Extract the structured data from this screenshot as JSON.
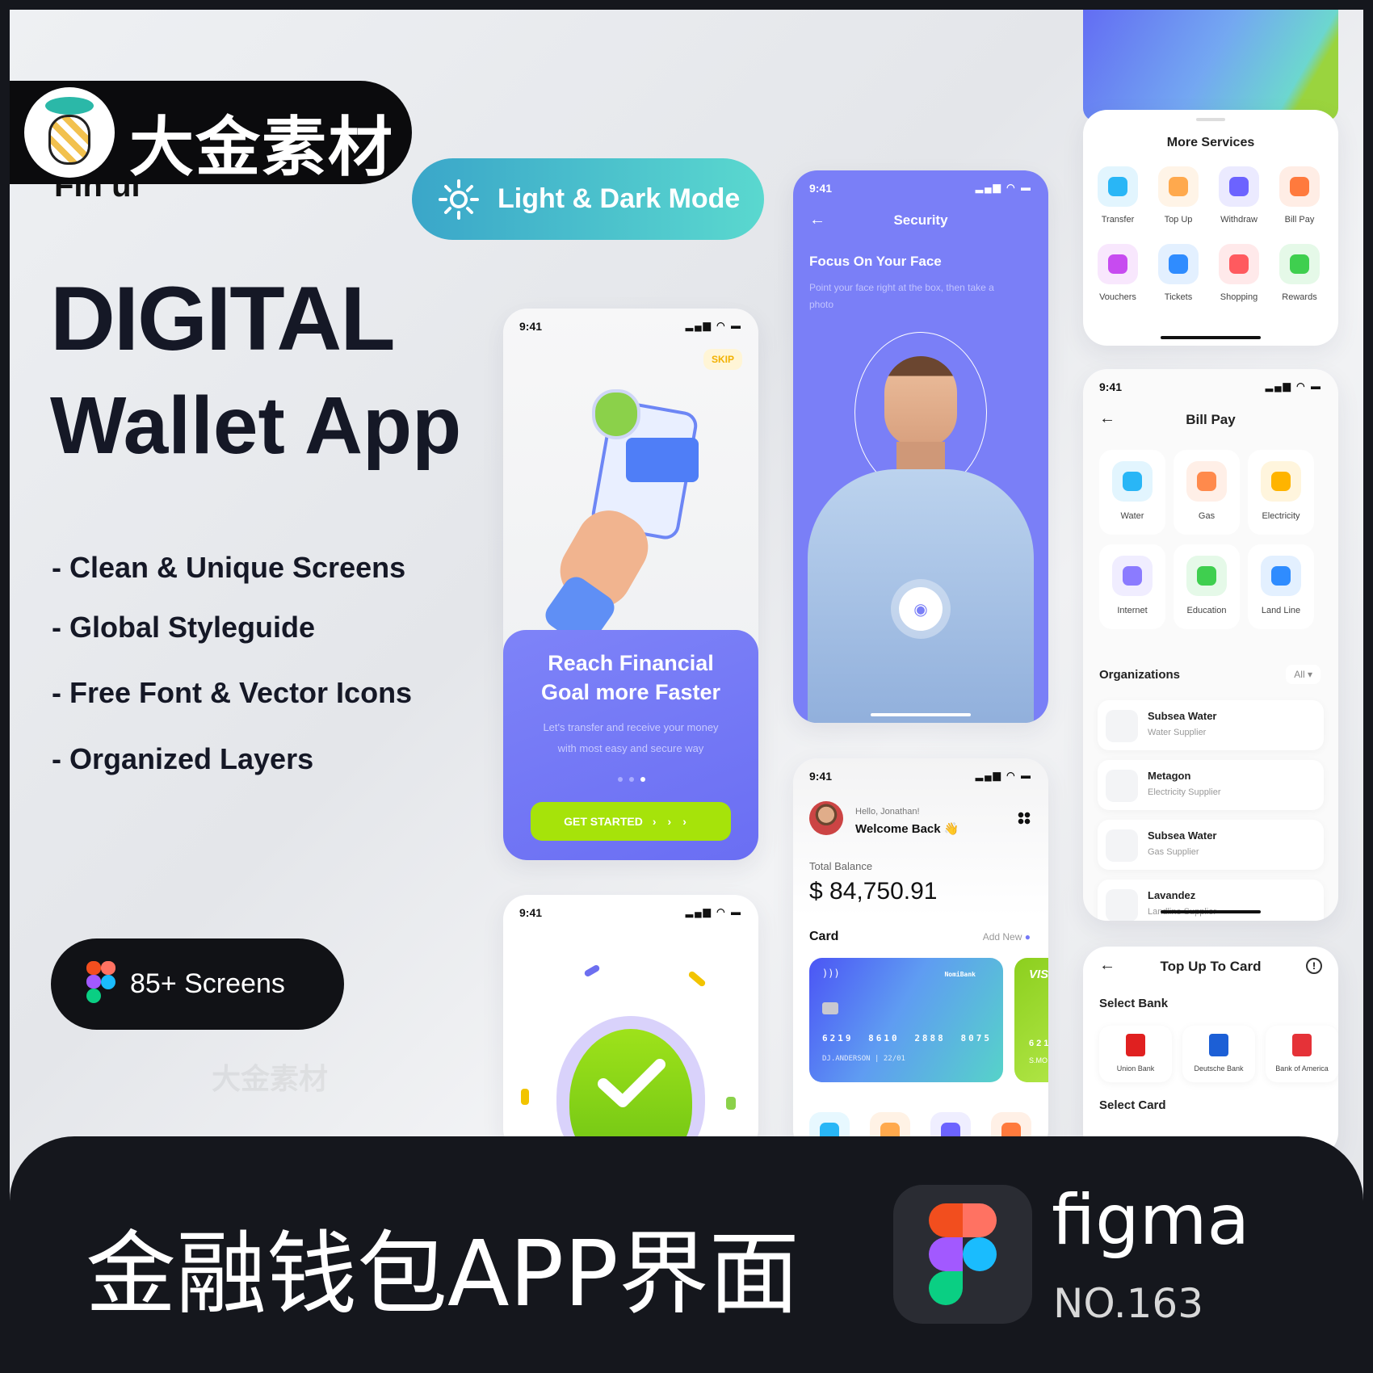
{
  "watermark": {
    "brand": "大金素材"
  },
  "logo_partial": "Fin ui",
  "mode_pill": {
    "label": "Light & Dark Mode",
    "icon": "sun-icon"
  },
  "hero": {
    "line1": "DIGITAL",
    "line2": "Wallet App"
  },
  "features": [
    "- Clean & Unique Screens",
    "- Global Styleguide",
    "- Free Font & Vector Icons",
    "- Organized Layers"
  ],
  "screens_pill": {
    "label": "85+ Screens",
    "icon": "figma-icon"
  },
  "status_time": "9:41",
  "onboarding": {
    "skip": "SKIP",
    "title1": "Reach Financial",
    "title2": "Goal more Faster",
    "desc1": "Let's transfer and receive your money",
    "desc2": "with most easy and secure way",
    "cta": "GET STARTED",
    "page_index": 3,
    "page_count": 3
  },
  "security": {
    "title": "Security",
    "heading": "Focus On Your Face",
    "desc": "Point your face right at the box, then take a photo"
  },
  "home": {
    "greeting": "Hello, Jonathan!",
    "welcome": "Welcome Back 👋",
    "balance_label": "Total Balance",
    "balance": "$ 84,750.91",
    "card_label": "Card",
    "add_new": "Add New",
    "card": {
      "bank": "NomiBank",
      "number": [
        "6219",
        "8610",
        "2888",
        "8075"
      ],
      "holder": "DJ.ANDERSON | 22/01"
    },
    "card2": {
      "brand": "VIS",
      "number": "621",
      "holder": "S.MO"
    }
  },
  "more_services": {
    "title": "More Services",
    "items": [
      {
        "label": "Transfer",
        "color": "#29b6f6"
      },
      {
        "label": "Top Up",
        "color": "#ffa94d"
      },
      {
        "label": "Withdraw",
        "color": "#6c63ff"
      },
      {
        "label": "Bill Pay",
        "color": "#ff7a3d"
      },
      {
        "label": "Vouchers",
        "color": "#c74bf0"
      },
      {
        "label": "Tickets",
        "color": "#2f8cff"
      },
      {
        "label": "Shopping",
        "color": "#ff5a5f"
      },
      {
        "label": "Rewards",
        "color": "#3fcf4f"
      }
    ]
  },
  "bill_pay": {
    "title": "Bill Pay",
    "categories": [
      {
        "label": "Water",
        "color": "#29b6f6"
      },
      {
        "label": "Gas",
        "color": "#ff8a4c"
      },
      {
        "label": "Electricity",
        "color": "#ffb400"
      },
      {
        "label": "Internet",
        "color": "#8b7bff"
      },
      {
        "label": "Education",
        "color": "#3fcf4f"
      },
      {
        "label": "Land Line",
        "color": "#2f8cff"
      }
    ],
    "org_title": "Organizations",
    "filter": "All",
    "orgs": [
      {
        "name": "Subsea Water",
        "type": "Water Supplier"
      },
      {
        "name": "Metagon",
        "type": "Electricity Supplier"
      },
      {
        "name": "Subsea Water",
        "type": "Gas Supplier"
      },
      {
        "name": "Lavandez",
        "type": "Landline Supplier"
      }
    ]
  },
  "top_up": {
    "title": "Top Up To Card",
    "select_bank": "Select Bank",
    "banks": [
      "Union Bank",
      "Deutsche Bank",
      "Bank of America"
    ],
    "select_card": "Select Card"
  },
  "footer": {
    "title": "金融钱包APP界面",
    "tool": "figma",
    "number": "NO.163"
  },
  "colors": {
    "primary": "#7478f7",
    "accent_green": "#a6e30a",
    "dark": "#15171d",
    "teal_start": "#3aa6c9",
    "teal_end": "#5ad8cf"
  }
}
